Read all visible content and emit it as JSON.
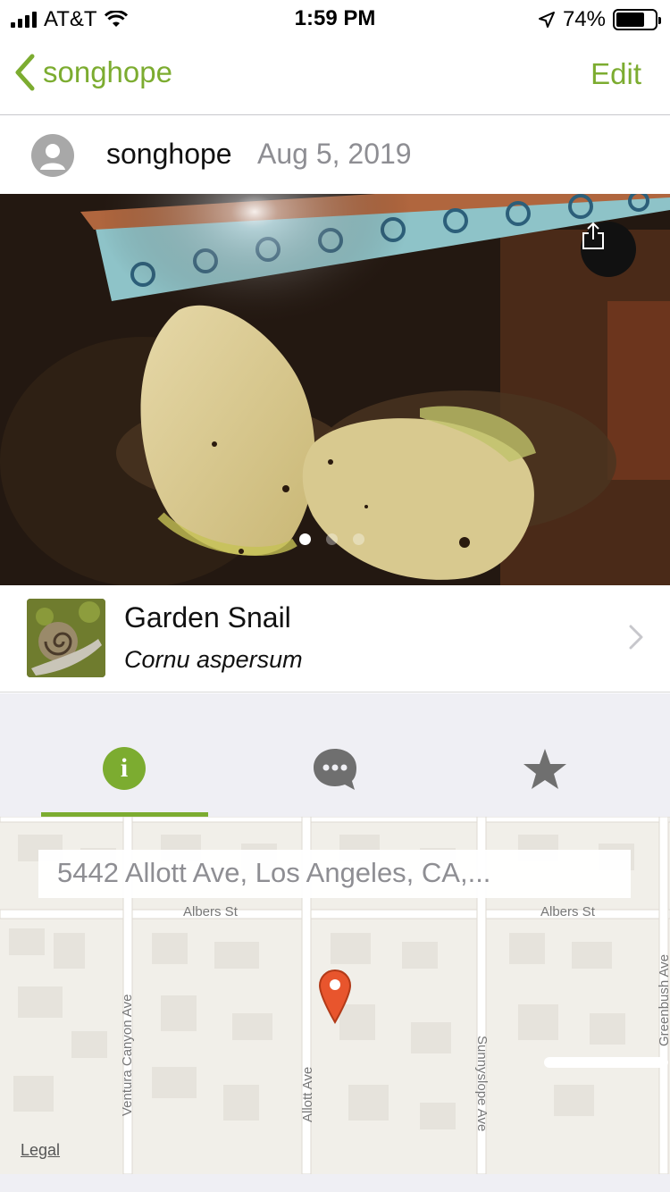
{
  "status_bar": {
    "carrier": "AT&T",
    "time": "1:59 PM",
    "battery": "74%",
    "battery_level": 0.74,
    "icons": [
      "signal-icon",
      "wifi-icon",
      "location-arrow-icon",
      "battery-icon"
    ]
  },
  "nav": {
    "back_label": "songhope",
    "edit_label": "Edit",
    "icons": [
      "chevron-left-icon"
    ]
  },
  "observation": {
    "username": "songhope",
    "date": "Aug 5, 2019",
    "photo_count": 3,
    "current_photo": 1,
    "icons": [
      "user-avatar-icon",
      "share-icon"
    ]
  },
  "species": {
    "common_name": "Garden Snail",
    "scientific_name": "Cornu aspersum",
    "icons": [
      "chevron-right-icon"
    ]
  },
  "tabs": [
    {
      "id": "info",
      "icon": "info-icon",
      "selected": true
    },
    {
      "id": "activity",
      "icon": "comment-icon",
      "selected": false
    },
    {
      "id": "favorites",
      "icon": "star-icon",
      "selected": false
    }
  ],
  "map": {
    "address": "5442 Allott Ave, Los Angeles, CA,...",
    "legal": "Legal",
    "streets": [
      "Albers St",
      "Albers St",
      "Ventura Canyon Ave",
      "Allott Ave",
      "Sunnyslope Ave",
      "Greenbush Ave"
    ],
    "icons": [
      "map-pin-icon"
    ]
  },
  "colors": {
    "accent": "#7cac30",
    "secondary_text": "#8e8e93",
    "tab_background": "#efeff4",
    "pin": "#e8552d"
  }
}
